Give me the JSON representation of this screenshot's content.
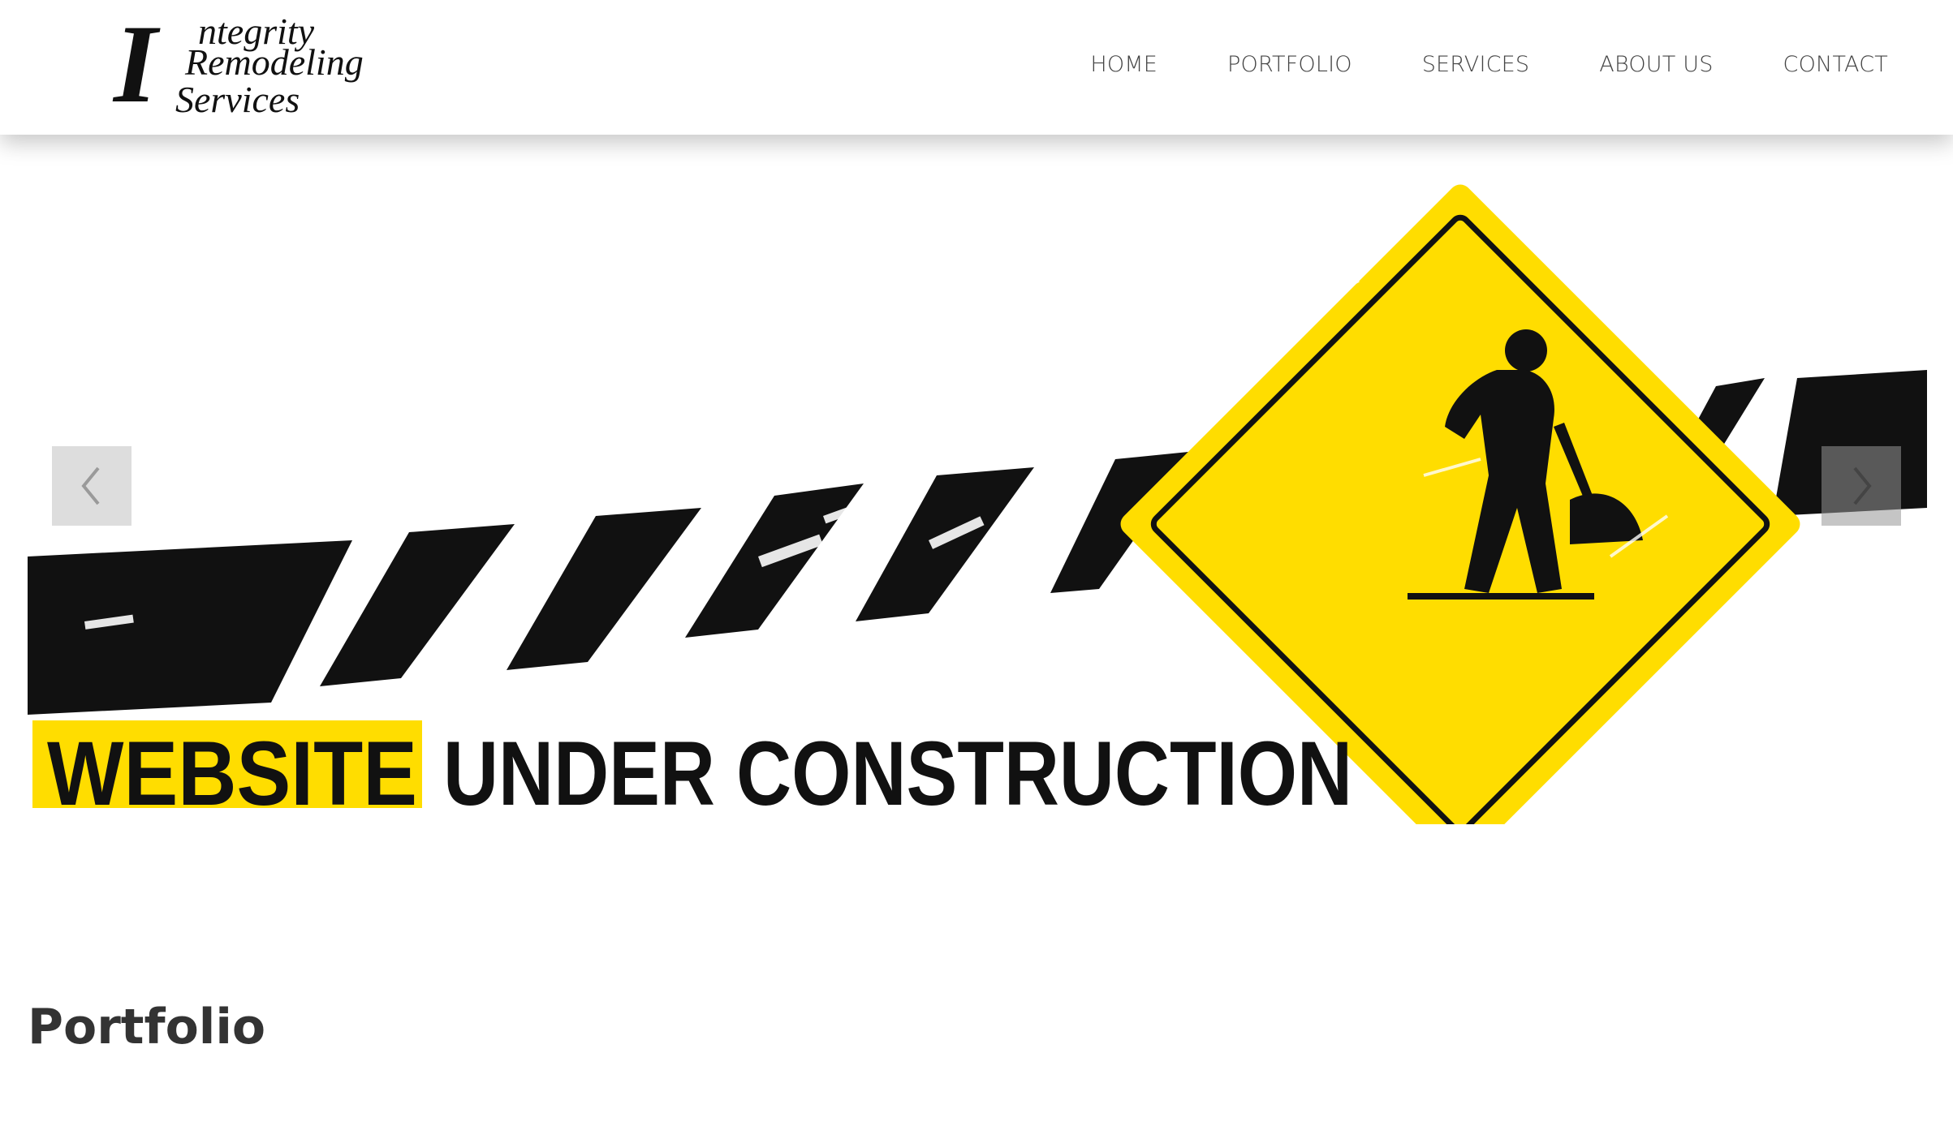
{
  "brand": {
    "logo_initial": "I",
    "logo_line1": "ntegrity",
    "logo_line2": "Remodeling",
    "logo_line3": "Services"
  },
  "nav": {
    "items": [
      {
        "label": "HOME"
      },
      {
        "label": "PORTFOLIO"
      },
      {
        "label": "SERVICES"
      },
      {
        "label": "ABOUT US"
      },
      {
        "label": "CONTACT"
      }
    ]
  },
  "hero": {
    "banner_word1": "WEBSITE",
    "banner_word2": "UNDER CONSTRUCTION",
    "prev_icon": "chevron-left-icon",
    "next_icon": "chevron-right-icon",
    "accent_color": "#FFDD00"
  },
  "section": {
    "title": "Portfolio"
  }
}
